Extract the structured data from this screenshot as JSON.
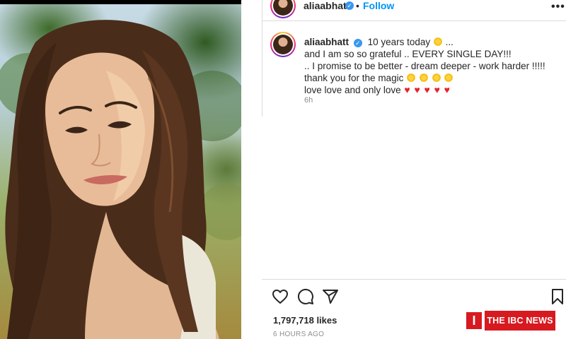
{
  "post": {
    "username": "aliaabhatt",
    "verified_glyph": "✓",
    "separator": "•",
    "follow_label": "Follow",
    "more_label": "•••",
    "photo_icon": "portrait-photo",
    "caption": {
      "username": "aliaabhatt",
      "line1_text": "10 years today",
      "line1_suffix": "...",
      "line2": "and I am so so grateful .. EVERY SINGLE DAY!!!",
      "line3": ".. I promise to be better - dream deeper - work harder !!!!!",
      "line4_text": "thank you for the magic",
      "line5_text": "love love and only love",
      "sun_emoji_count_line4": 4,
      "heart_emoji_count_line5": 5,
      "heart_glyph": "♥"
    },
    "time_posted": "6h",
    "likes": "1,797,718 likes",
    "posted_ago": "6 HOURS AGO",
    "icons": [
      "heart-icon",
      "comment-icon",
      "share-icon",
      "bookmark-icon"
    ]
  },
  "watermark": {
    "mark": "I",
    "text": "THE IBC NEWS",
    "color": "#d71920"
  },
  "colors": {
    "link_blue": "#0095f6",
    "verified_blue": "#3897f0",
    "muted_gray": "#8e8e8e",
    "divider": "#dbdbdb",
    "heart_red": "#e5232b"
  }
}
